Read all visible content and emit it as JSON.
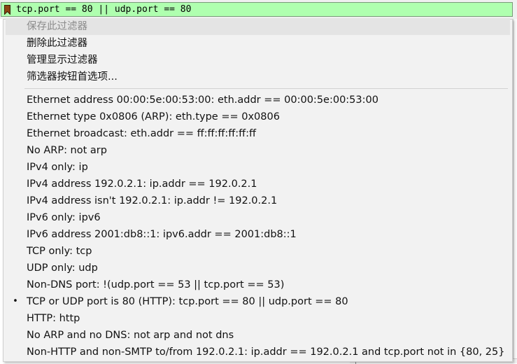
{
  "filter_bar": {
    "value": "tcp.port == 80 || udp.port == 80",
    "bookmark_icon": "bookmark-icon",
    "bookmark_color": "#8b4513",
    "background_color": "#afffaf"
  },
  "menu": {
    "header_items": [
      {
        "label": "保存此过滤器",
        "enabled": false
      },
      {
        "label": "删除此过滤器",
        "enabled": true
      },
      {
        "label": "管理显示过滤器",
        "enabled": true
      },
      {
        "label": "筛选器按钮首选项...",
        "enabled": true
      }
    ],
    "filters": [
      {
        "label": "Ethernet address 00:00:5e:00:53:00: eth.addr == 00:00:5e:00:53:00"
      },
      {
        "label": "Ethernet type 0x0806 (ARP): eth.type == 0x0806"
      },
      {
        "label": "Ethernet broadcast: eth.addr == ff:ff:ff:ff:ff:ff"
      },
      {
        "label": "No ARP: not arp"
      },
      {
        "label": "IPv4 only: ip"
      },
      {
        "label": "IPv4 address 192.0.2.1: ip.addr == 192.0.2.1"
      },
      {
        "label": "IPv4 address isn't 192.0.2.1: ip.addr != 192.0.2.1"
      },
      {
        "label": "IPv6 only: ipv6"
      },
      {
        "label": "IPv6 address 2001:db8::1: ipv6.addr == 2001:db8::1"
      },
      {
        "label": "TCP only: tcp"
      },
      {
        "label": "UDP only: udp"
      },
      {
        "label": "Non-DNS port: !(udp.port == 53 || tcp.port == 53)"
      },
      {
        "label": "TCP or UDP port is 80 (HTTP): tcp.port == 80 || udp.port == 80",
        "selected": true
      },
      {
        "label": "HTTP: http"
      },
      {
        "label": "No ARP and no DNS: not arp and not dns"
      },
      {
        "label": "Non-HTTP and non-SMTP to/from 192.0.2.1: ip.addr == 192.0.2.1 and tcp.port not in {80, 25}"
      }
    ],
    "selected_marker": "•"
  }
}
